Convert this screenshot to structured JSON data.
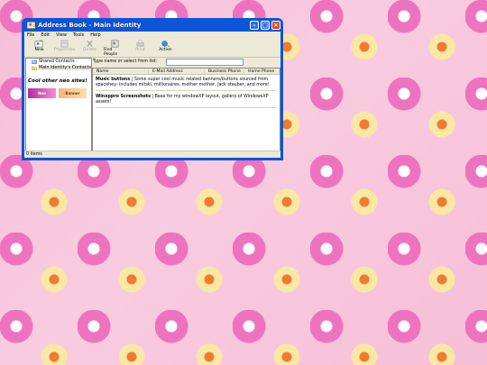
{
  "window": {
    "title": "Address Book - Main Identity",
    "menu": [
      "File",
      "Edit",
      "View",
      "Tools",
      "Help"
    ],
    "toolbar": [
      {
        "label": "New",
        "icon": "new-contact-icon",
        "enabled": true
      },
      {
        "label": "Properties",
        "icon": "properties-icon",
        "enabled": false
      },
      {
        "label": "Delete",
        "icon": "delete-icon",
        "enabled": false
      },
      {
        "label": "Find People",
        "icon": "find-people-icon",
        "enabled": true
      },
      {
        "label": "Print",
        "icon": "print-icon",
        "enabled": false
      },
      {
        "label": "Action",
        "icon": "action-icon",
        "enabled": true
      }
    ],
    "tree": [
      {
        "label": "Shared Contacts",
        "icon": "shared-contacts-icon"
      },
      {
        "label": "Main Identity's Contacts",
        "icon": "folder-icon"
      }
    ],
    "cool_sites": "Cool other neo sites!",
    "banners": [
      "Neo",
      "Banner"
    ],
    "search_label": "Type name or select from list:",
    "search_value": "",
    "columns": [
      "Name",
      "E-Mail Address",
      "Business Phone",
      "Home Phone"
    ],
    "entries": [
      {
        "title": "Music buttons",
        "text": " | Some super cool music related banners/buttons sourced from spacehey- includes mitski, millionaires, mother mother, jack stauber, and more!"
      },
      {
        "title": "Winxppro Screenshots",
        "text": " | Base for my windowXP layout, gallery of WindowsXP assets!"
      }
    ],
    "status": "0 items"
  },
  "colors": {
    "titlebar": "#0b55d8",
    "window_bg": "#ece9d8",
    "desktop_pink": "#f4b3d4",
    "flower_magenta": "#ee73bf",
    "flower_orange": "#f07a2f",
    "flower_cream": "#f9e7a3"
  }
}
